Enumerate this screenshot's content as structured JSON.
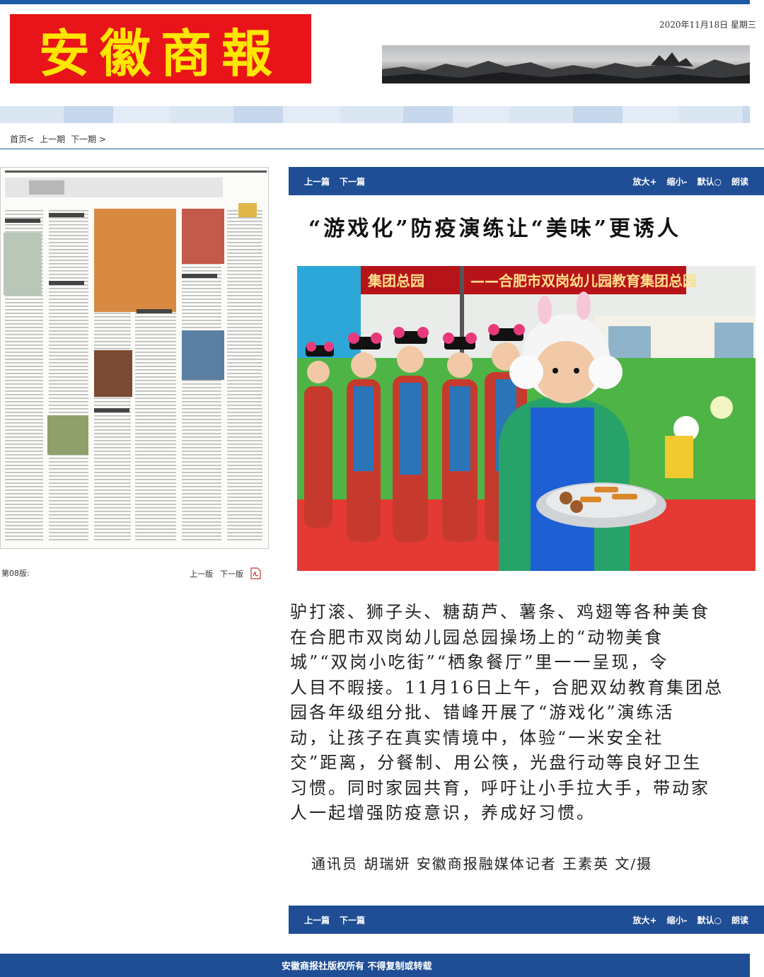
{
  "header": {
    "logo_text": "安徽商報",
    "date": "2020年11月18日 星期三"
  },
  "nav": {
    "home": "首页<",
    "prev_issue": "上一期",
    "next_issue": "下一期 >"
  },
  "page_thumb": {
    "edition": "第08版:",
    "prev_page": "上一版",
    "next_page": "下一版"
  },
  "article_bar": {
    "prev_article": "上一篇",
    "next_article": "下一篇",
    "zoom_in": "放大+",
    "zoom_out": "缩小-",
    "default": "默认○",
    "read_aloud": "朗读"
  },
  "article": {
    "title": "“游戏化”防疫演练让“美味”更诱人",
    "photo_banner": "——合肥市双岗幼儿园教育集团总园",
    "photo_banner_left": "集团总园",
    "body_lines": [
      "驴打滚、狮子头、糖葫芦、薯条、鸡翅等各种美食",
      "在合肥市双岗幼儿园总园操场上的“动物美食",
      "城”“双岗小吃街”“栖象餐厅”里一一呈现，令",
      "人目不暇接。11月16日上午，合肥双幼教育集团总",
      "园各年级组分批、错峰开展了“游戏化”演练活",
      "动，让孩子在真实情境中，体验“一米安全社",
      "交”距离，分餐制、用公筷，光盘行动等良好卫生",
      "习惯。同时家园共育，呼吁让小手拉大手，带动家",
      "人一起增强防疫意识，养成好习惯。"
    ],
    "byline": "通讯员 胡瑞妍 安徽商报融媒体记者 王素英 文/摄"
  },
  "footer": {
    "copyright": "安徽商报社版权所有 不得复制或转载"
  },
  "colors": {
    "brand_blue": "#1f4e95",
    "logo_red": "#e8141a",
    "logo_yellow": "#ffe600"
  }
}
